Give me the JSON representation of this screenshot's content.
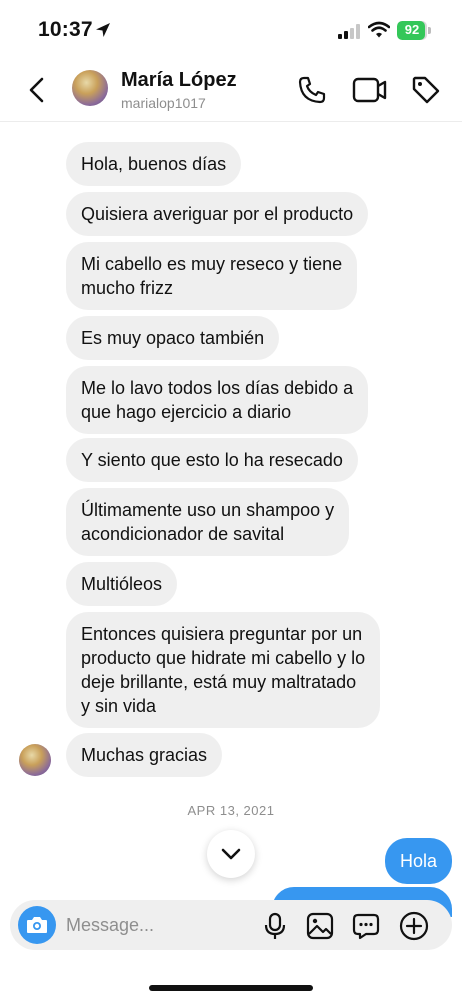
{
  "status_bar": {
    "time": "10:37",
    "battery": "92",
    "battery_level": 0.92,
    "icons": [
      "location-arrow-icon",
      "signal-icon",
      "wifi-icon",
      "battery-icon"
    ]
  },
  "header": {
    "name": "María López",
    "handle": "marialop1017",
    "icons": [
      "back-icon",
      "avatar",
      "phone-icon",
      "video-icon",
      "tag-icon"
    ]
  },
  "messages": [
    {
      "text": "Hola, buenos días",
      "from": "them"
    },
    {
      "text": "Quisiera averiguar por el producto",
      "from": "them"
    },
    {
      "text": "Mi cabello es muy reseco y tiene\nmucho frizz",
      "from": "them"
    },
    {
      "text": "Es muy opaco también",
      "from": "them"
    },
    {
      "text": "Me lo lavo todos los días debido a\nque hago ejercicio a diario",
      "from": "them"
    },
    {
      "text": "Y siento que esto lo ha resecado",
      "from": "them"
    },
    {
      "text": "Últimamente uso un shampoo y\nacondicionador de savital",
      "from": "them"
    },
    {
      "text": "Multióleos",
      "from": "them"
    },
    {
      "text": "Entonces quisiera preguntar por un\nproducto que hidrate mi cabello y lo\ndeje brillante, está muy maltratado\ny sin vida",
      "from": "them"
    },
    {
      "text": "Muchas gracias",
      "from": "them"
    }
  ],
  "date_separator": "APR 13, 2021",
  "outgoing": [
    {
      "text": "Hola",
      "from": "me"
    }
  ],
  "composer": {
    "placeholder": "Message...",
    "icons": [
      "camera-icon",
      "mic-icon",
      "gallery-icon",
      "sticker-icon",
      "plus-icon"
    ]
  },
  "colors": {
    "accent": "#3797f0",
    "incoming_bubble": "#efefef",
    "battery_green": "#34c759",
    "secondary_text": "#8e8e8e"
  }
}
